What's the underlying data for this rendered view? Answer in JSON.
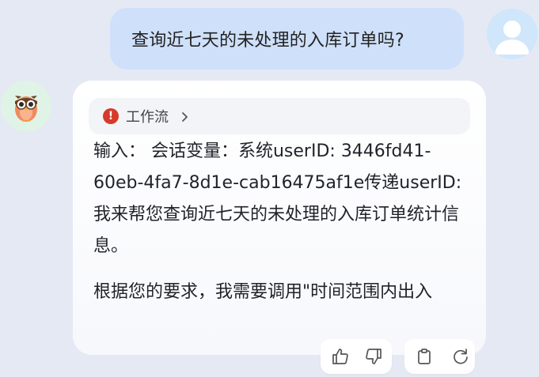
{
  "user_message": {
    "text": "查询近七天的未处理的入库订单吗?"
  },
  "bot_message": {
    "workflow": {
      "label": "工作流",
      "status_icon": "error-icon",
      "expand_icon": "chevron-right-icon"
    },
    "paragraphs": [
      "输入： 会话变量：系统userID: 3446fd41-60eb-4fa7-8d1e-cab16475af1e传递userID:我来帮您查询近七天的未处理的入库订单统计信息。",
      "根据您的要求，我需要调用\"时间范围内出入"
    ]
  },
  "actions": {
    "like_icon": "thumb-up-icon",
    "dislike_icon": "thumb-down-icon",
    "copy_icon": "clipboard-icon",
    "regenerate_icon": "refresh-icon"
  },
  "colors": {
    "background": "#e4e9f4",
    "user_bubble": "#cfe0fa",
    "error_red": "#d63a2a"
  }
}
